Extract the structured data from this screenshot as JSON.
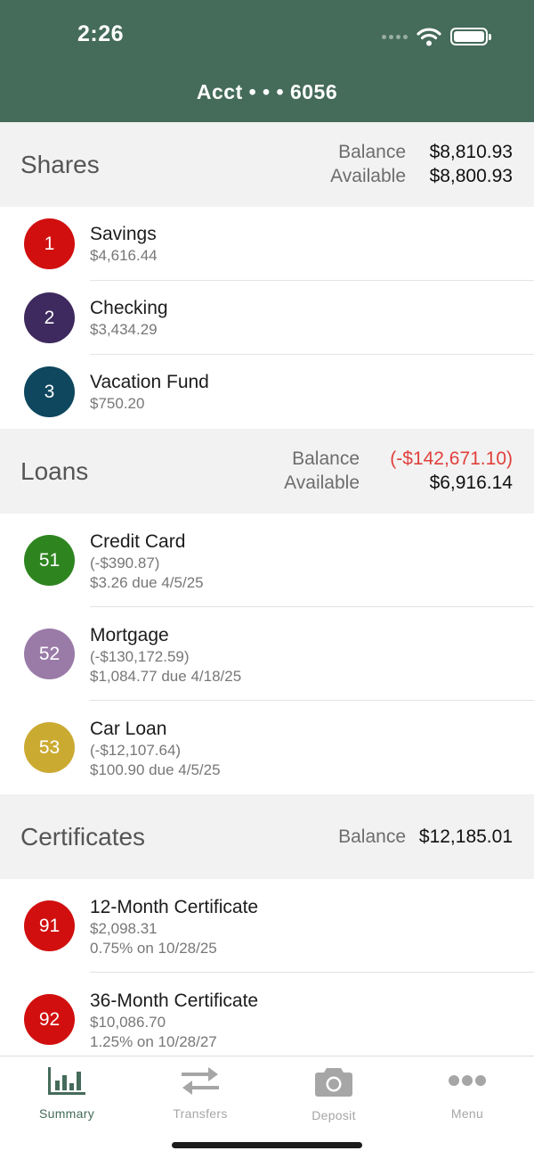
{
  "status_bar": {
    "time": "2:26",
    "icons": [
      "cellular-signal-icon",
      "wifi-icon",
      "battery-icon"
    ]
  },
  "header": {
    "title": "Acct • • • 6056"
  },
  "colors": {
    "header_bg": "#456b5a",
    "negative": "#e0403c",
    "badge_red": "#d10f0f",
    "badge_purple": "#3e2a5e",
    "badge_teal": "#0e475e",
    "badge_green": "#2e851f",
    "badge_lavender": "#9a7ba8",
    "badge_gold": "#cbaa32"
  },
  "shares": {
    "title": "Shares",
    "balance_label": "Balance",
    "balance_value": "$8,810.93",
    "available_label": "Available",
    "available_value": "$8,800.93",
    "items": [
      {
        "number": "1",
        "name": "Savings",
        "amount": "$4,616.44"
      },
      {
        "number": "2",
        "name": "Checking",
        "amount": "$3,434.29"
      },
      {
        "number": "3",
        "name": "Vacation Fund",
        "amount": "$750.20"
      }
    ]
  },
  "loans": {
    "title": "Loans",
    "balance_label": "Balance",
    "balance_value": "(-$142,671.10)",
    "available_label": "Available",
    "available_value": "$6,916.14",
    "items": [
      {
        "number": "51",
        "name": "Credit Card",
        "amount": "(-$390.87)",
        "detail": "$3.26 due 4/5/25"
      },
      {
        "number": "52",
        "name": "Mortgage",
        "amount": "(-$130,172.59)",
        "detail": "$1,084.77 due 4/18/25"
      },
      {
        "number": "53",
        "name": "Car Loan",
        "amount": "(-$12,107.64)",
        "detail": "$100.90 due 4/5/25"
      }
    ]
  },
  "certificates": {
    "title": "Certificates",
    "balance_label": "Balance",
    "balance_value": "$12,185.01",
    "items": [
      {
        "number": "91",
        "name": "12-Month Certificate",
        "amount": "$2,098.31",
        "detail": "0.75% on 10/28/25"
      },
      {
        "number": "92",
        "name": "36-Month Certificate",
        "amount": "$10,086.70",
        "detail": "1.25% on 10/28/27"
      }
    ]
  },
  "tabbar": {
    "tabs": [
      {
        "label": "Summary",
        "icon": "bar-chart-icon",
        "active": true
      },
      {
        "label": "Transfers",
        "icon": "transfer-arrows-icon",
        "active": false
      },
      {
        "label": "Deposit",
        "icon": "camera-icon",
        "active": false
      },
      {
        "label": "Menu",
        "icon": "more-dots-icon",
        "active": false
      }
    ]
  }
}
